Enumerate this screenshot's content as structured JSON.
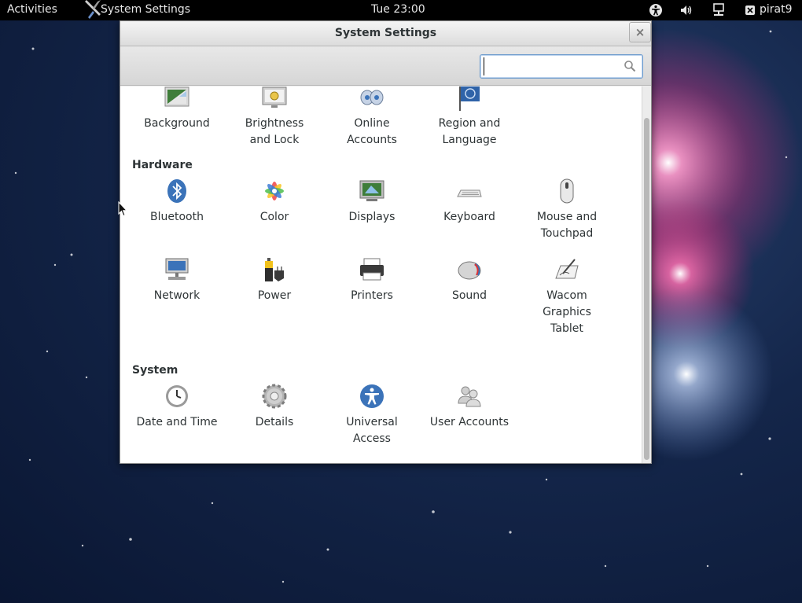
{
  "top_bar": {
    "activities_label": "Activities",
    "app_name": "System Settings",
    "clock": "Tue 23:00",
    "user_name": "pirat9",
    "status_icons": [
      "accessibility-icon",
      "volume-icon",
      "network-wired-icon",
      "user-status-icon"
    ]
  },
  "window": {
    "title": "System Settings",
    "close_glyph": "×",
    "search": {
      "value": "",
      "placeholder": ""
    }
  },
  "personal": {
    "items": [
      {
        "label": "Background",
        "icon": "background-icon"
      },
      {
        "label": "Brightness\nand Lock",
        "icon": "brightness-lock-icon"
      },
      {
        "label": "Online\nAccounts",
        "icon": "online-accounts-icon"
      },
      {
        "label": "Region and\nLanguage",
        "icon": "region-language-icon"
      }
    ]
  },
  "hardware": {
    "title": "Hardware",
    "items": [
      {
        "label": "Bluetooth",
        "icon": "bluetooth-icon"
      },
      {
        "label": "Color",
        "icon": "color-icon"
      },
      {
        "label": "Displays",
        "icon": "displays-icon"
      },
      {
        "label": "Keyboard",
        "icon": "keyboard-icon"
      },
      {
        "label": "Mouse and\nTouchpad",
        "icon": "mouse-icon"
      },
      {
        "label": "Network",
        "icon": "network-icon"
      },
      {
        "label": "Power",
        "icon": "power-icon"
      },
      {
        "label": "Printers",
        "icon": "printer-icon"
      },
      {
        "label": "Sound",
        "icon": "sound-icon"
      },
      {
        "label": "Wacom\nGraphics\nTablet",
        "icon": "wacom-tablet-icon"
      }
    ]
  },
  "system": {
    "title": "System",
    "items": [
      {
        "label": "Date and Time",
        "icon": "clock-icon"
      },
      {
        "label": "Details",
        "icon": "gear-icon"
      },
      {
        "label": "Universal\nAccess",
        "icon": "universal-access-icon"
      },
      {
        "label": "User Accounts",
        "icon": "user-accounts-icon"
      }
    ]
  },
  "colors": {
    "top_bar_bg": "#000000",
    "window_bg": "#ededed",
    "search_focus": "#6e9ccd",
    "accent_blue": "#3b73b9"
  }
}
